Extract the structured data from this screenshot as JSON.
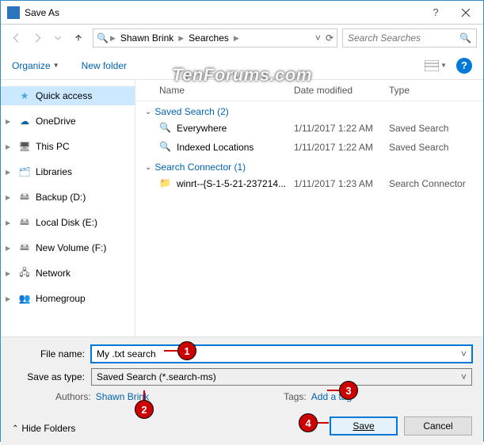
{
  "window": {
    "title": "Save As",
    "help_tooltip": "?"
  },
  "nav": {
    "breadcrumb": [
      "Shawn Brink",
      "Searches"
    ],
    "refresh_icon": "refresh",
    "search_placeholder": "Search Searches"
  },
  "toolbar": {
    "organize": "Organize",
    "new_folder": "New folder",
    "view_icon": "view-details",
    "help_icon": "?"
  },
  "sidebar": {
    "items": [
      {
        "label": "Quick access",
        "icon": "star",
        "selected": true,
        "expandable": false
      },
      {
        "label": "OneDrive",
        "icon": "cloud",
        "expandable": true
      },
      {
        "label": "This PC",
        "icon": "pc",
        "expandable": true
      },
      {
        "label": "Libraries",
        "icon": "libs",
        "expandable": true
      },
      {
        "label": "Backup (D:)",
        "icon": "drive",
        "expandable": true
      },
      {
        "label": "Local Disk (E:)",
        "icon": "drive",
        "expandable": true
      },
      {
        "label": "New Volume (F:)",
        "icon": "drive",
        "expandable": true
      },
      {
        "label": "Network",
        "icon": "net",
        "expandable": true
      },
      {
        "label": "Homegroup",
        "icon": "home",
        "expandable": true
      }
    ]
  },
  "filelist": {
    "columns": {
      "name": "Name",
      "date": "Date modified",
      "type": "Type"
    },
    "groups": [
      {
        "label": "Saved Search (2)",
        "rows": [
          {
            "name": "Everywhere",
            "date": "1/11/2017 1:22 AM",
            "type": "Saved Search",
            "icon": "search"
          },
          {
            "name": "Indexed Locations",
            "date": "1/11/2017 1:22 AM",
            "type": "Saved Search",
            "icon": "search"
          }
        ]
      },
      {
        "label": "Search Connector (1)",
        "rows": [
          {
            "name": "winrt--{S-1-5-21-237214...",
            "date": "1/11/2017 1:23 AM",
            "type": "Search Connector",
            "icon": "folder-search"
          }
        ]
      }
    ]
  },
  "form": {
    "filename_label": "File name:",
    "filename_value": "My .txt search",
    "saveastype_label": "Save as type:",
    "saveastype_value": "Saved Search (*.search-ms)",
    "authors_label": "Authors:",
    "authors_value": "Shawn Brink",
    "tags_label": "Tags:",
    "tags_value": "Add a tag",
    "hide_folders": "Hide Folders",
    "save": "Save",
    "cancel": "Cancel"
  },
  "callouts": {
    "c1": "1",
    "c2": "2",
    "c3": "3",
    "c4": "4"
  },
  "watermark": "TenForums.com"
}
